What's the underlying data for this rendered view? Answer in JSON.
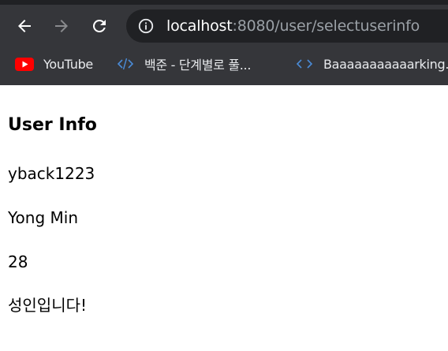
{
  "browser": {
    "url_host": "localhost",
    "url_rest": ":8080/user/selectuserinfo",
    "bookmarks": [
      {
        "label": "YouTube",
        "icon": "youtube-icon"
      },
      {
        "label": "백준 - 단계별로 풀...",
        "icon": "code-icon"
      },
      {
        "label": "Baaaaaaaaaaarking...",
        "icon": "code-icon"
      }
    ],
    "colors": {
      "toolbar": "#35363a",
      "omnibox": "#202124",
      "youtube_red": "#ff0000",
      "code_icon_blue": "#4a8bd6"
    }
  },
  "page": {
    "title": "User Info",
    "user_id": "yback1223",
    "user_name": "Yong Min",
    "user_age": "28",
    "message": "성인입니다!"
  }
}
